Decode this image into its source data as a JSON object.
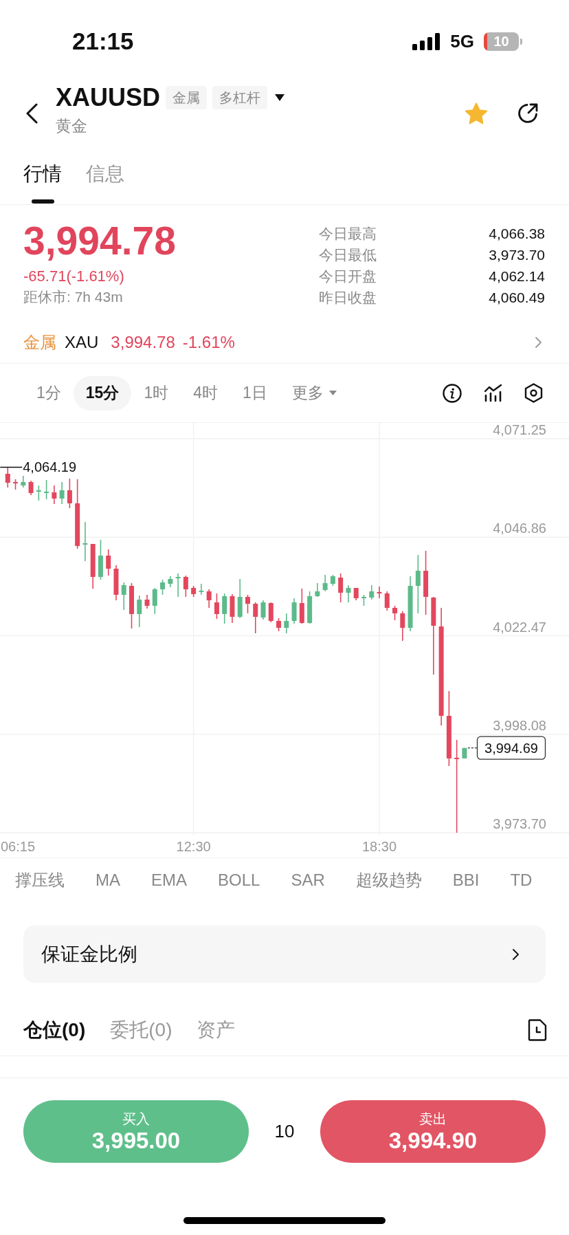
{
  "status_bar": {
    "time": "21:15",
    "network": "5G",
    "battery": "10"
  },
  "header": {
    "symbol": "XAUUSD",
    "tags": [
      "金属",
      "多杠杆"
    ],
    "name": "黄金",
    "favorite": true
  },
  "tabs": [
    {
      "label": "行情",
      "selected": true
    },
    {
      "label": "信息",
      "selected": false
    }
  ],
  "quote": {
    "price": "3,994.78",
    "change": "-65.71(-1.61%)",
    "countdown": "距休市: 7h 43m",
    "stats": [
      {
        "label": "今日最高",
        "value": "4,066.38"
      },
      {
        "label": "今日最低",
        "value": "3,973.70"
      },
      {
        "label": "今日开盘",
        "value": "4,062.14"
      },
      {
        "label": "昨日收盘",
        "value": "4,060.49"
      }
    ]
  },
  "underlying": {
    "category": "金属",
    "symbol": "XAU",
    "price": "3,994.78",
    "change": "-1.61%"
  },
  "intervals": [
    {
      "label": "1分",
      "selected": false
    },
    {
      "label": "15分",
      "selected": true
    },
    {
      "label": "1时",
      "selected": false
    },
    {
      "label": "4时",
      "selected": false
    },
    {
      "label": "1日",
      "selected": false
    }
  ],
  "more_menu": {
    "label": "更多"
  },
  "chart": {
    "chart_data": {
      "type": "candlestick",
      "grid": true,
      "x": [
        6.5,
        6.75,
        7,
        7.25,
        7.5,
        7.75,
        8,
        8.25,
        8.5,
        8.75,
        9,
        9.25,
        9.5,
        9.75,
        10,
        10.25,
        10.5,
        10.75,
        11,
        11.25,
        11.5,
        11.75,
        12,
        12.25,
        12.5,
        12.75,
        13,
        13.25,
        13.5,
        13.75,
        14,
        14.25,
        14.5,
        14.75,
        15,
        15.25,
        15.5,
        15.75,
        16,
        16.25,
        16.5,
        16.75,
        17,
        17.25,
        17.5,
        17.75,
        18,
        18.25,
        18.5,
        18.75,
        19,
        19.25,
        19.5,
        19.75,
        20,
        20.25,
        20.5,
        20.75,
        21,
        21.25
      ],
      "ohlc": [
        [
          4062.57,
          4064.19,
          4059.16,
          4060.35
        ],
        [
          4060.52,
          4061.21,
          4058.65,
          4060.18
        ],
        [
          4059.67,
          4062.06,
          4059.16,
          4060.52
        ],
        [
          4060.52,
          4060.87,
          4057.29,
          4057.8
        ],
        [
          4058.14,
          4059.67,
          4055.93,
          4058.48
        ],
        [
          4057.8,
          4061.04,
          4056.27,
          4058.14
        ],
        [
          4057.97,
          4059.67,
          4055.08,
          4056.44
        ],
        [
          4056.44,
          4060.52,
          4055.08,
          4058.48
        ],
        [
          4058.48,
          4061.38,
          4054.06,
          4055.25
        ],
        [
          4055.25,
          4061.21,
          4044.01,
          4044.69
        ],
        [
          4045.03,
          4050.65,
          4040.95,
          4045.37
        ],
        [
          4045.2,
          4045.2,
          4034.14,
          4037.03
        ],
        [
          4037.03,
          4046.22,
          4036.35,
          4042.31
        ],
        [
          4042.31,
          4043.84,
          4037.37,
          4039.07
        ],
        [
          4039.07,
          4039.93,
          4031.24,
          4032.61
        ],
        [
          4032.61,
          4035.67,
          4028.86,
          4034.99
        ],
        [
          4034.82,
          4035.5,
          4024.26,
          4027.84
        ],
        [
          4027.84,
          4032.44,
          4024.6,
          4031.41
        ],
        [
          4031.41,
          4032.61,
          4029.2,
          4029.88
        ],
        [
          4029.88,
          4034.31,
          4027.84,
          4033.97
        ],
        [
          4033.97,
          4036.35,
          4032.61,
          4035.67
        ],
        [
          4035.33,
          4037.2,
          4034.48,
          4036.52
        ],
        [
          4036.69,
          4037.88,
          4032.09,
          4037.03
        ],
        [
          4037.03,
          4037.37,
          4032.09,
          4033.97
        ],
        [
          4034.31,
          4034.82,
          4032.09,
          4032.78
        ],
        [
          4033.29,
          4035.33,
          4032.61,
          4033.63
        ],
        [
          4033.46,
          4033.97,
          4029.37,
          4031.24
        ],
        [
          4030.73,
          4032.95,
          4026.65,
          4027.84
        ],
        [
          4027.84,
          4032.95,
          4025.46,
          4032.27
        ],
        [
          4032.27,
          4032.78,
          4025.63,
          4027.16
        ],
        [
          4027.16,
          4036.52,
          4026.82,
          4032.09
        ],
        [
          4032.09,
          4032.61,
          4028.01,
          4030.39
        ],
        [
          4030.39,
          4030.73,
          4023.07,
          4027.16
        ],
        [
          4026.99,
          4031.24,
          4026.48,
          4030.73
        ],
        [
          4030.56,
          4030.73,
          4025.8,
          4026.14
        ],
        [
          4026.14,
          4026.82,
          4023.58,
          4024.43
        ],
        [
          4024.43,
          4028.01,
          4023.07,
          4026.14
        ],
        [
          4026.14,
          4031.75,
          4025.46,
          4030.73
        ],
        [
          4030.56,
          4034.14,
          4025.46,
          4025.63
        ],
        [
          4025.63,
          4033.46,
          4025.46,
          4032.27
        ],
        [
          4032.27,
          4035.5,
          4032.09,
          4033.46
        ],
        [
          4033.8,
          4037.54,
          4033.46,
          4035.5
        ],
        [
          4035.33,
          4037.54,
          4034.82,
          4037.2
        ],
        [
          4036.86,
          4037.88,
          4030.73,
          4033.12
        ],
        [
          4033.12,
          4034.99,
          4030.73,
          4034.31
        ],
        [
          4034.31,
          4034.31,
          4031.24,
          4031.75
        ],
        [
          4031.75,
          4032.61,
          4029.88,
          4032.09
        ],
        [
          4031.92,
          4034.99,
          4031.41,
          4033.46
        ],
        [
          4033.29,
          4034.65,
          4031.75,
          4032.95
        ],
        [
          4032.95,
          4033.46,
          4028.69,
          4029.37
        ],
        [
          4029.37,
          4029.88,
          4026.31,
          4028.01
        ],
        [
          4028.01,
          4028.52,
          4021.2,
          4024.43
        ],
        [
          4024.43,
          4037.2,
          4023.58,
          4034.82
        ],
        [
          4034.82,
          4042.48,
          4028.01,
          4038.56
        ],
        [
          4038.56,
          4043.5,
          4027.67,
          4032.09
        ],
        [
          4031.92,
          4032.09,
          4012.86,
          4024.94
        ],
        [
          4024.77,
          4029.37,
          4000.26,
          4002.64
        ],
        [
          4002.64,
          4008.77,
          3990.22,
          3992.09
        ],
        [
          3992.26,
          3996.68,
          3973.7,
          3991.92
        ],
        [
          3992.09,
          3994.69,
          3992.09,
          3994.69
        ]
      ],
      "xlim": [
        6.25,
        24.625
      ],
      "ylim": [
        3874.1,
        4179.87
      ],
      "xticks": [
        {
          "value": 6.25,
          "label": "06:15"
        },
        {
          "value": 12.5,
          "label": "12:30"
        },
        {
          "value": 18.5,
          "label": "18:30"
        }
      ],
      "yticks": [
        {
          "value": 4071.25,
          "label": "4,071.25"
        },
        {
          "value": 4046.86,
          "label": "4,046.86"
        },
        {
          "value": 4022.47,
          "label": "4,022.47"
        },
        {
          "value": 3998.08,
          "label": "3,998.08"
        },
        {
          "value": 3973.7,
          "label": "3,973.70"
        }
      ],
      "annotations": [
        {
          "text": "4,064.19",
          "x": 6.5,
          "y": 4064.19
        },
        {
          "text": "3,994.69",
          "x": 21.25,
          "y": 3994.69
        }
      ]
    }
  },
  "indicators": [
    "撑压线",
    "MA",
    "EMA",
    "BOLL",
    "SAR",
    "超级趋势",
    "BBI",
    "TD"
  ],
  "margin_ratio": {
    "label": "保证金比例"
  },
  "position_tabs": [
    {
      "label": "仓位(0)",
      "selected": true
    },
    {
      "label": "委托(0)",
      "selected": false
    },
    {
      "label": "资产",
      "selected": false
    }
  ],
  "trade": {
    "buy": {
      "label": "买入",
      "price": "3,995.00"
    },
    "quantity": "10",
    "sell": {
      "label": "卖出",
      "price": "3,994.90"
    }
  }
}
